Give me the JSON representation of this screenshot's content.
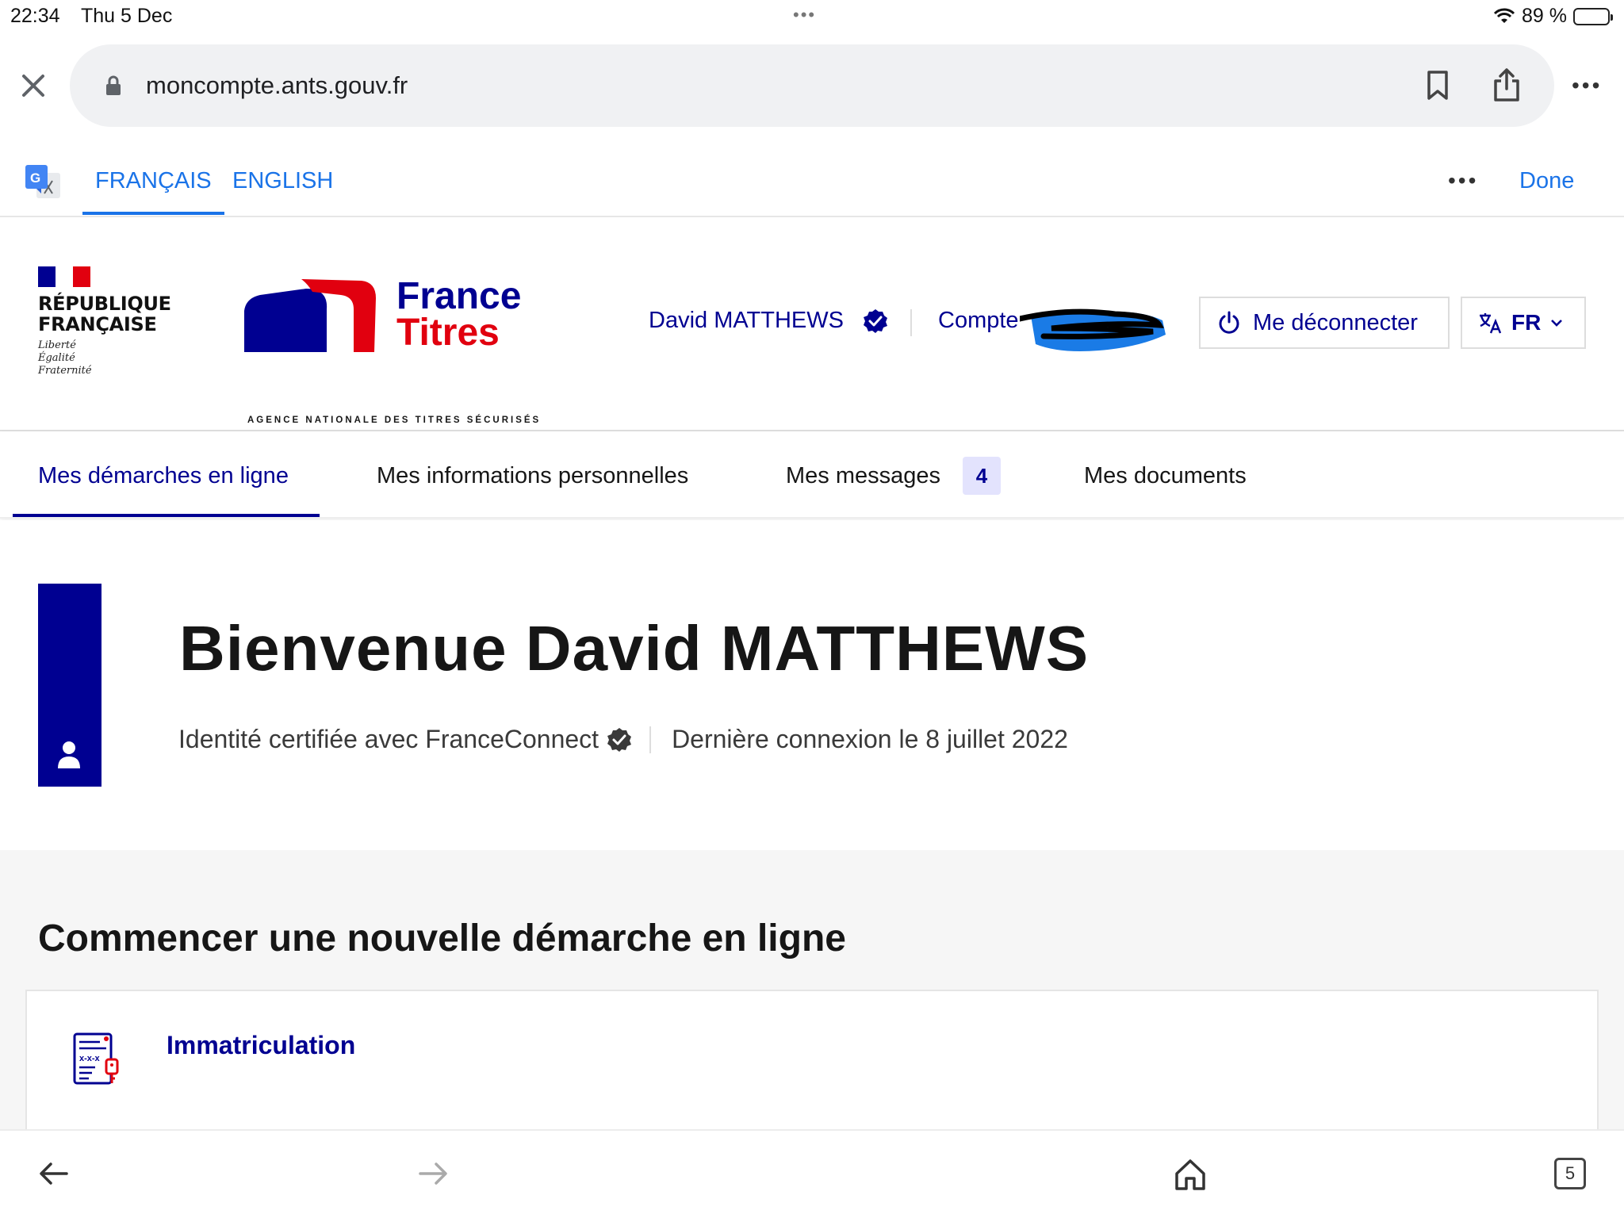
{
  "status_bar": {
    "time": "22:34",
    "date": "Thu 5 Dec",
    "battery": "89 %"
  },
  "browser": {
    "url": "moncompte.ants.gouv.fr"
  },
  "translate_bar": {
    "lang_fr": "FRANÇAIS",
    "lang_en": "ENGLISH",
    "done": "Done"
  },
  "header": {
    "rf_line1": "RÉPUBLIQUE",
    "rf_line2": "FRANÇAISE",
    "motto_1": "Liberté",
    "motto_2": "Égalité",
    "motto_3": "Fraternité",
    "logo_line1": "France",
    "logo_line2": "Titres",
    "logo_agency": "AGENCE NATIONALE DES TITRES SÉCURISÉS",
    "user_name": "David MATTHEWS",
    "compte_label": "Compte",
    "logout_label": "Me déconnecter",
    "lang_label": "FR"
  },
  "nav": {
    "tabs": [
      {
        "label": "Mes démarches en ligne"
      },
      {
        "label": "Mes informations personnelles"
      },
      {
        "label": "Mes messages"
      },
      {
        "label": "Mes documents"
      }
    ],
    "messages_count": "4"
  },
  "welcome": {
    "title": "Bienvenue David MATTHEWS",
    "identity": "Identité certifiée avec FranceConnect",
    "last_login": "Dernière connexion le 8 juillet 2022"
  },
  "new_procedure": {
    "title": "Commencer une nouvelle démarche en ligne",
    "card_title": "Immatriculation"
  },
  "bottom_bar": {
    "tabs_count": "5"
  },
  "colors": {
    "primary_blue": "#000091",
    "marianne_red": "#e1000f",
    "link_blue": "#1a73e8",
    "badge_bg": "#e3e3fd"
  }
}
